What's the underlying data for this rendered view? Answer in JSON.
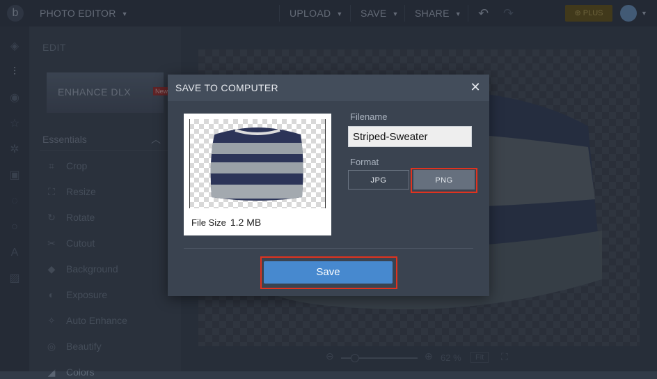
{
  "topbar": {
    "app_title": "PHOTO EDITOR",
    "upload": "UPLOAD",
    "save": "SAVE",
    "share": "SHARE",
    "plus": "PLUS"
  },
  "edit_panel": {
    "heading": "EDIT",
    "banner": "ENHANCE DLX",
    "banner_badge": "New",
    "section": "Essentials",
    "items": [
      "Crop",
      "Resize",
      "Rotate",
      "Cutout",
      "Background",
      "Exposure",
      "Auto Enhance",
      "Beautify",
      "Colors"
    ]
  },
  "zoom": {
    "value": "62 %",
    "fit": "Fit"
  },
  "dialog": {
    "title": "SAVE TO COMPUTER",
    "filename_label": "Filename",
    "filename_value": "Striped-Sweater",
    "format_label": "Format",
    "formats": [
      "JPG",
      "PNG"
    ],
    "selected_format": "PNG",
    "file_size_label": "File Size",
    "file_size_value": "1.2 MB",
    "save_label": "Save"
  },
  "colors": {
    "accent_blue": "#4789cf",
    "highlight_red": "#e0331f",
    "plus_badge": "#6b5a1c"
  }
}
